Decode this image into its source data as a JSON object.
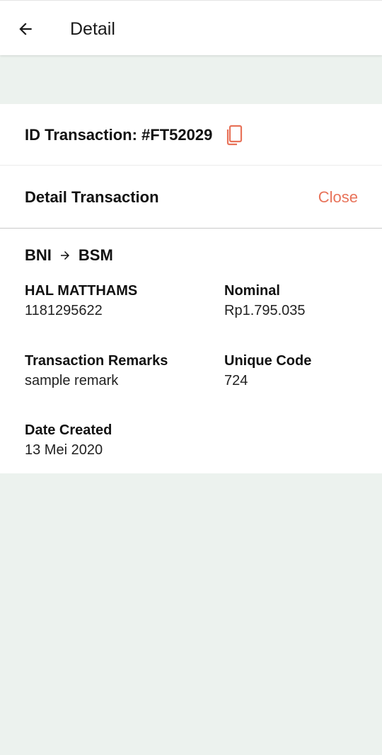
{
  "header": {
    "title": "Detail"
  },
  "transaction": {
    "id_label": "ID Transaction: #FT52029"
  },
  "detail": {
    "title": "Detail Transaction",
    "close_label": "Close",
    "from_bank": "BNI",
    "to_bank": "BSM",
    "account_name": "HAL MATTHAMS",
    "account_number": "1181295622",
    "nominal_label": "Nominal",
    "nominal_value": "Rp1.795.035",
    "remarks_label": "Transaction Remarks",
    "remarks_value": "sample remark",
    "unique_code_label": "Unique Code",
    "unique_code_value": "724",
    "date_label": "Date Created",
    "date_value": "13 Mei 2020"
  },
  "icons": {
    "back": "arrow-left-icon",
    "copy": "copy-icon",
    "route_arrow": "arrow-right-icon"
  },
  "colors": {
    "accent": "#e8735a",
    "background": "#ecf2ee",
    "card": "#ffffff"
  }
}
